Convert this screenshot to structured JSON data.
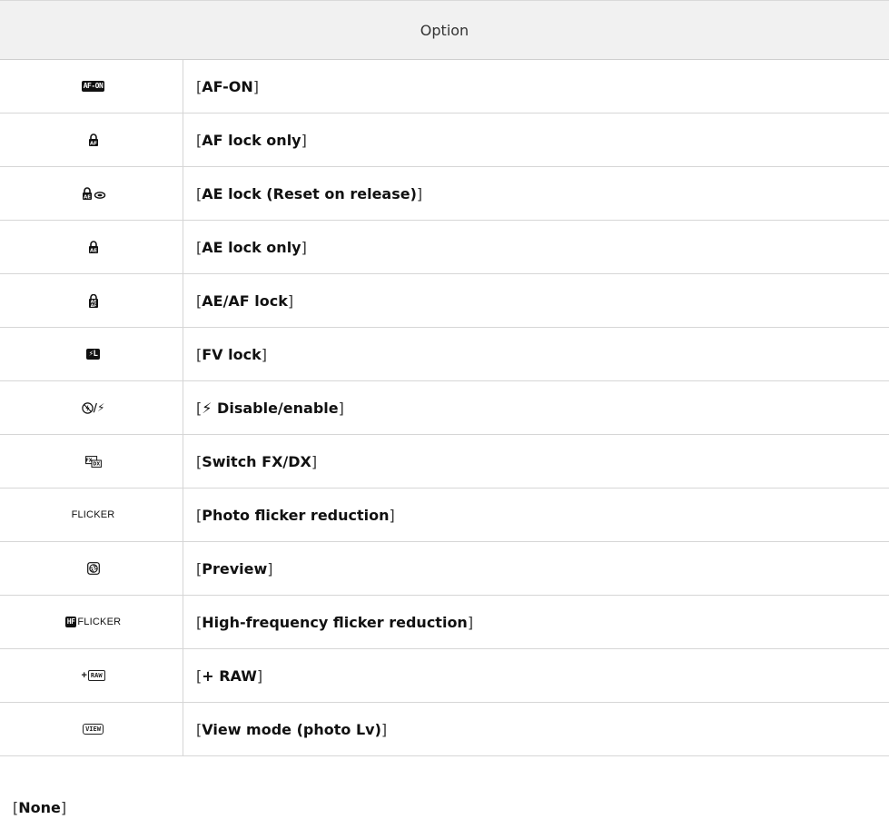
{
  "table": {
    "header": "Option",
    "rows": [
      {
        "icon": "af-on-icon",
        "label": "AF-ON"
      },
      {
        "icon": "af-lock-icon",
        "label": "AF lock only"
      },
      {
        "icon": "ae-lock-reset-icon",
        "label": "AE lock (Reset on release)"
      },
      {
        "icon": "ae-lock-icon",
        "label": "AE lock only"
      },
      {
        "icon": "ae-af-lock-icon",
        "label": "AE/AF lock"
      },
      {
        "icon": "fv-lock-icon",
        "label": "FV lock"
      },
      {
        "icon": "flash-disable-enable-icon",
        "label": "⚡ Disable/enable"
      },
      {
        "icon": "switch-fx-dx-icon",
        "label": "Switch FX/DX"
      },
      {
        "icon": "flicker-icon",
        "label": "Photo flicker reduction"
      },
      {
        "icon": "preview-icon",
        "label": "Preview"
      },
      {
        "icon": "hf-flicker-icon",
        "label": "High-frequency flicker reduction"
      },
      {
        "icon": "plus-raw-icon",
        "label": "+ RAW"
      },
      {
        "icon": "view-icon",
        "label": "View mode (photo Lv)"
      }
    ]
  },
  "icon_text": {
    "af_on": "AF-ON",
    "af": "AF",
    "ae": "AE",
    "fv": "⚡L",
    "flash": "/⚡",
    "fx": "FX",
    "dx": "DX",
    "flicker": "FLICKER",
    "hf": "HF",
    "hf_flicker": "FLICKER",
    "plus": "+",
    "raw": "RAW",
    "view": "VIEW"
  },
  "footer": {
    "none_label": "None"
  }
}
